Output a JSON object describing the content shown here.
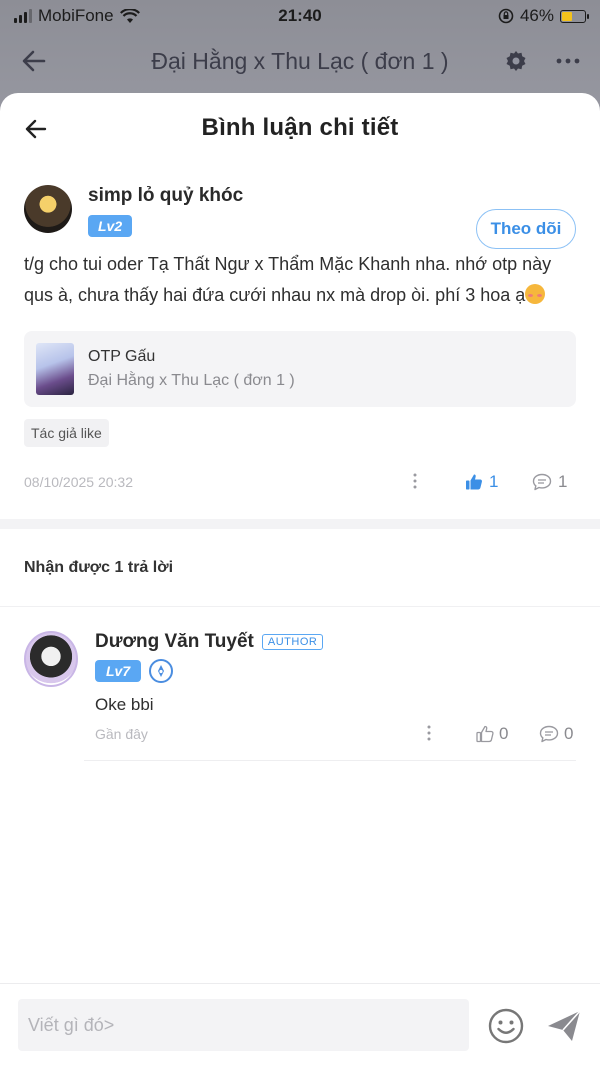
{
  "status_bar": {
    "carrier": "MobiFone",
    "time": "21:40",
    "battery": "46%",
    "battery_level": 0.46
  },
  "background_nav": {
    "title": "Đại Hằng x Thu Lạc ( đơn 1 )"
  },
  "sheet": {
    "title": "Bình luận chi tiết"
  },
  "comment": {
    "author": "simp lỏ quỷ khóc",
    "level": "Lv2",
    "follow_label": "Theo dõi",
    "text": "t/g cho tui oder Tạ Thất Ngư x Thẩm Mặc Khanh nha. nhớ otp này qus à, chưa thấy hai đứa cưới nhau nx mà drop òi. phí 3 hoa ạ",
    "book": {
      "title": "OTP Gấu",
      "subtitle": "Đại Hằng x Thu Lạc ( đơn 1 )"
    },
    "tag": "Tác giả like",
    "time": "08/10/2025 20:32",
    "likes": "1",
    "replies": "1"
  },
  "replies_header": "Nhận được 1 trả lời",
  "reply": {
    "author": "Dương Văn Tuyết",
    "author_tag": "AUTHOR",
    "level": "Lv7",
    "text": "Oke bbi",
    "time": "Gần đây",
    "likes": "0",
    "replies": "0"
  },
  "composer": {
    "placeholder": "Viết gì đó>"
  },
  "colors": {
    "accent": "#3b8fe6",
    "badge": "#5aa7f3",
    "battery": "#f3c21c"
  }
}
